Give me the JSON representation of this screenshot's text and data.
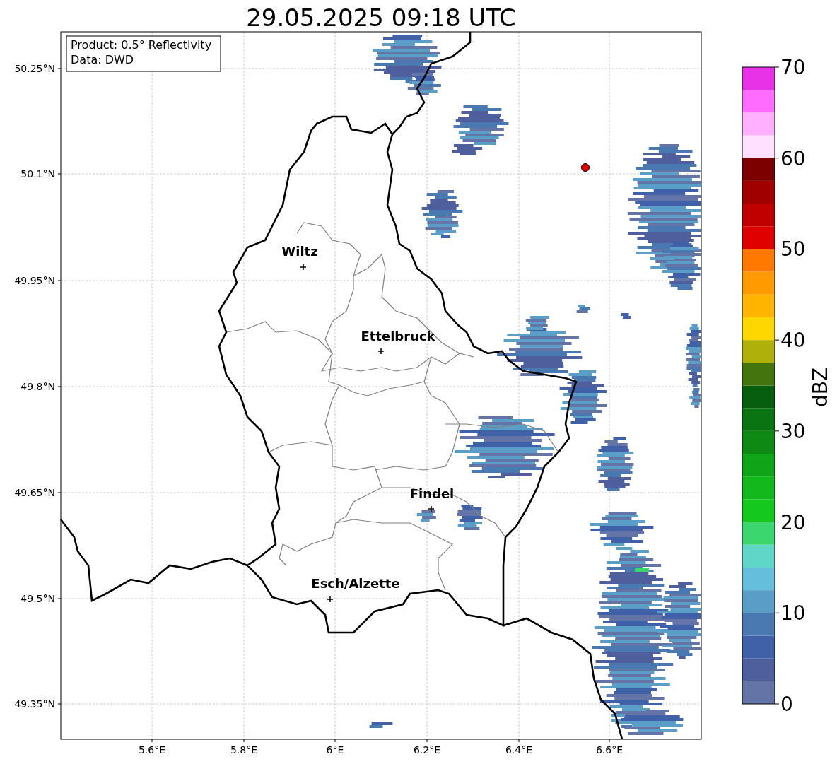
{
  "title": "29.05.2025 09:18 UTC",
  "info_box": [
    "Product: 0.5° Reflectivity",
    "Data: DWD"
  ],
  "lat_ticks": [
    "50.25°N",
    "50.1°N",
    "49.95°N",
    "49.8°N",
    "49.65°N",
    "49.5°N",
    "49.35°N"
  ],
  "lon_ticks": [
    "5.6°E",
    "5.8°E",
    "6°E",
    "6.2°E",
    "6.4°E",
    "6.6°E"
  ],
  "cities": [
    {
      "name": "Wiltz"
    },
    {
      "name": "Ettelbruck"
    },
    {
      "name": "Findel"
    },
    {
      "name": "Esch/Alzette"
    }
  ],
  "colorbar": {
    "label": "dBZ",
    "ticks": [
      "70",
      "60",
      "50",
      "40",
      "30",
      "20",
      "10",
      "0"
    ],
    "segments": [
      {
        "color": "#6474a6"
      },
      {
        "color": "#4f5f9e"
      },
      {
        "color": "#4060a8"
      },
      {
        "color": "#4a78b0"
      },
      {
        "color": "#5a9ec8"
      },
      {
        "color": "#64bedc"
      },
      {
        "color": "#5fd6c8"
      },
      {
        "color": "#3cd66e"
      },
      {
        "color": "#14c81e"
      },
      {
        "color": "#12b81c"
      },
      {
        "color": "#10a418"
      },
      {
        "color": "#0e8a14"
      },
      {
        "color": "#0a7412"
      },
      {
        "color": "#065e0e"
      },
      {
        "color": "#44740e"
      },
      {
        "color": "#b0b00a"
      },
      {
        "color": "#ffd700"
      },
      {
        "color": "#ffb400"
      },
      {
        "color": "#ff9a00"
      },
      {
        "color": "#ff7800"
      },
      {
        "color": "#e00000"
      },
      {
        "color": "#c00000"
      },
      {
        "color": "#a00000"
      },
      {
        "color": "#7d0000"
      },
      {
        "color": "#ffe0ff"
      },
      {
        "color": "#ffb0ff"
      },
      {
        "color": "#ff6cff"
      },
      {
        "color": "#e832e8"
      }
    ]
  }
}
